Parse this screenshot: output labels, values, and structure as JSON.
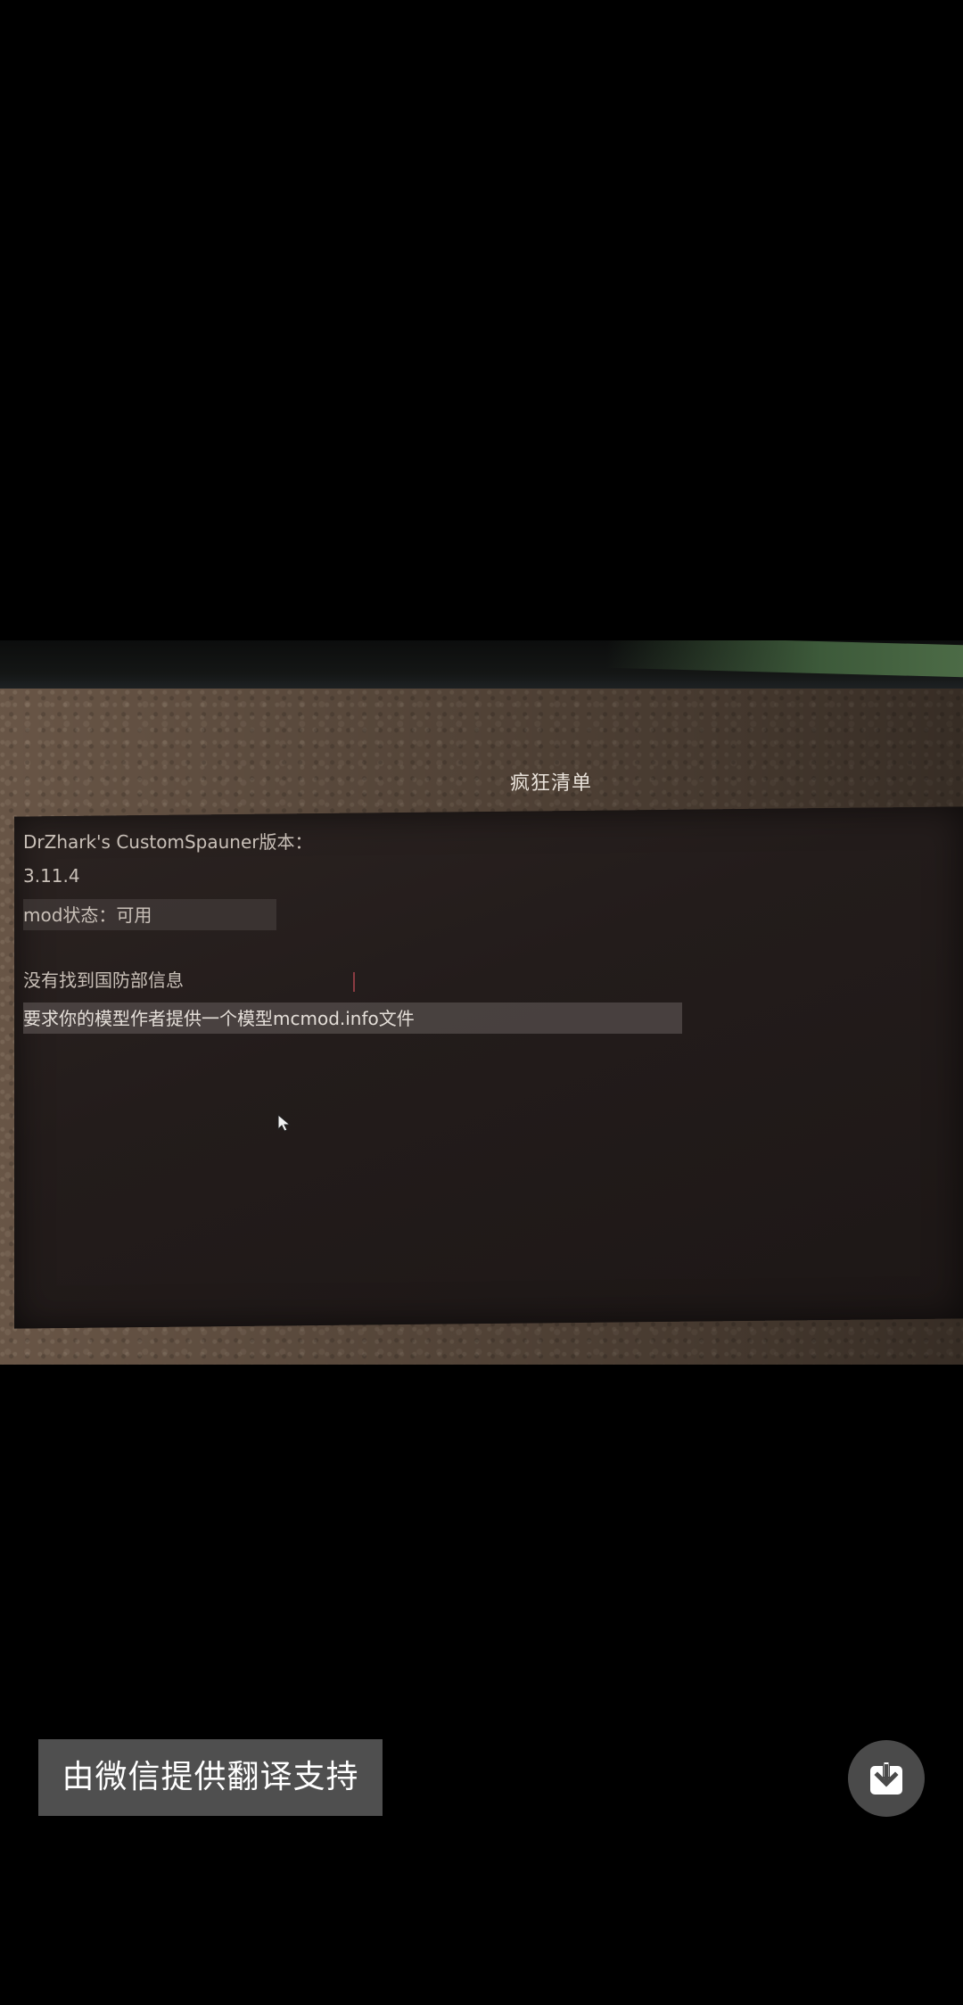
{
  "screen": {
    "title": "疯狂清单",
    "mod_version_label": "DrZhark's CustomSpauner版本：",
    "mod_version": "3.11.4",
    "mod_status": "mod状态：可用",
    "no_info": "没有找到国防部信息",
    "request": "要求你的模型作者提供一个模型mcmod.info文件"
  },
  "overlay": {
    "translate_badge": "由微信提供翻译支持",
    "download_icon": "download-icon"
  },
  "colors": {
    "background": "#000000",
    "badge": "#4f4f4f",
    "download_button": "#4a4a4a"
  }
}
